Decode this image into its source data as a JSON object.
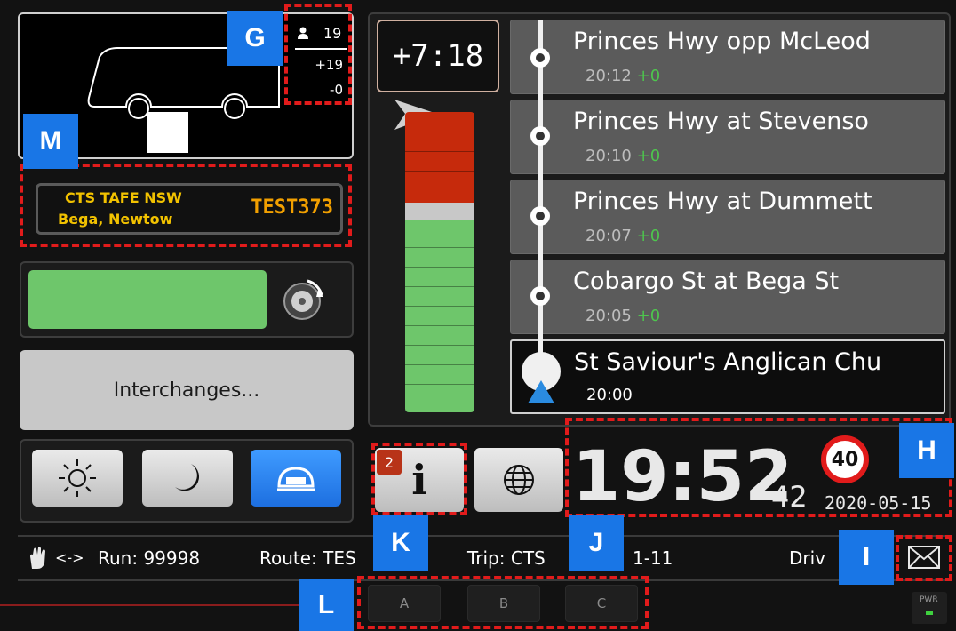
{
  "passengers": {
    "count": "19",
    "boarded": "+19",
    "alighted": "-0"
  },
  "destination": {
    "line1": "CTS TAFE NSW",
    "line2": "Bega, Newtow",
    "code": "TEST373"
  },
  "interchanges_label": "Interchanges...",
  "schedule": {
    "deviation": "+7:18"
  },
  "stops": [
    {
      "name": "Princes Hwy opp McLeod",
      "time": "20:12",
      "dev": "+0"
    },
    {
      "name": "Princes Hwy at Stevenso",
      "time": "20:10",
      "dev": "+0"
    },
    {
      "name": "Princes Hwy at Dummett",
      "time": "20:07",
      "dev": "+0"
    },
    {
      "name": "Cobargo St at Bega St",
      "time": "20:05",
      "dev": "+0"
    },
    {
      "name": "St Saviour's Anglican Chu",
      "time": "20:00",
      "dev": ""
    }
  ],
  "clock": {
    "hm": "19:52",
    "sec": "42",
    "date": "2020-05-15",
    "speed_limit": "40"
  },
  "info": {
    "badge": "2"
  },
  "status_bar": {
    "arrows": "<->",
    "run": "Run: 99998",
    "route": "Route: TES",
    "trip": "Trip: CTS",
    "trip_tail": "1-11",
    "driver": "Driv"
  },
  "schedule_buttons": [
    "A",
    "B",
    "C"
  ],
  "power_label": "PWR",
  "callouts": {
    "g": "G",
    "h": "H",
    "i": "I",
    "j": "J",
    "k": "K",
    "l": "L",
    "m": "M"
  },
  "colors": {
    "callout": "#1976e6",
    "annotation": "#e11b1b",
    "on_time": "#4ec64e",
    "behind": "#c62a0c"
  }
}
